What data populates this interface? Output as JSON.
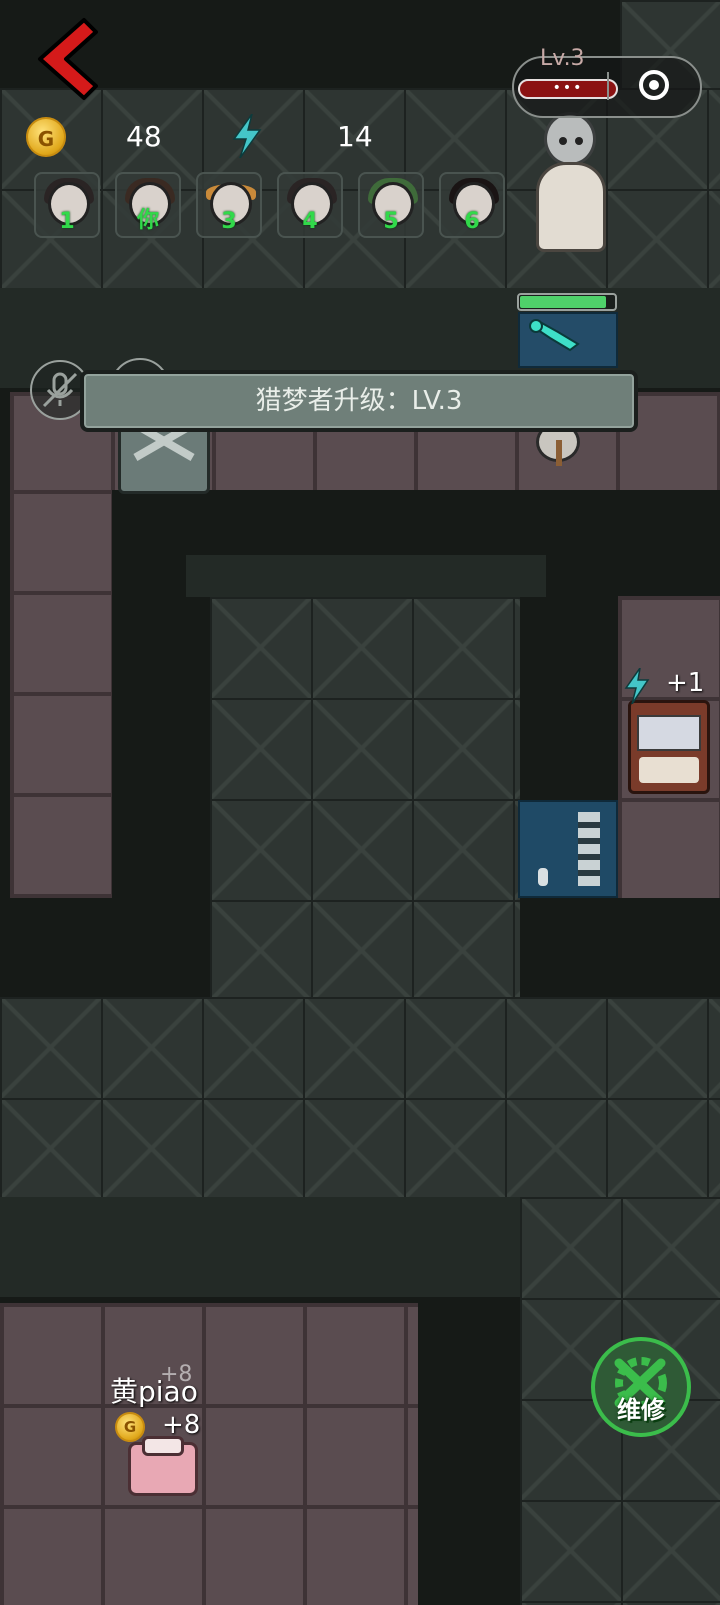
{
  "hud": {
    "gold": "48",
    "energy": "14",
    "coin_symbol": "G",
    "level_label": "Lv.3",
    "capsule_dots": "•••"
  },
  "slots": [
    {
      "num": "1",
      "hair": "#2a2424"
    },
    {
      "num": "你",
      "hair": "#3a2a22"
    },
    {
      "num": "3",
      "hair": "#c98a3a"
    },
    {
      "num": "4",
      "hair": "#2a2424"
    },
    {
      "num": "5",
      "hair": "#3f6b3a"
    },
    {
      "num": "6",
      "hair": "#1a1414"
    }
  ],
  "banner": {
    "text": "猎梦者升级：LV.3"
  },
  "machine": {
    "bonus": "+1"
  },
  "player": {
    "name": "黄piao",
    "gold_gain": "+8",
    "gold_gain_faded": "+8"
  },
  "repair_button": {
    "label": "维修"
  },
  "colors": {
    "back_arrow": "#d51a1a",
    "slot_number": "#31d94a",
    "repair_ring": "#3bbd4b",
    "energy_bolt": "#44c6c9",
    "hunter_hp": "#4fd16a"
  },
  "icons": [
    "back-arrow-icon",
    "coin-icon",
    "lightning-icon",
    "more-dots-icon",
    "target-icon",
    "mic-off-icon",
    "wrench-icon",
    "gear-wrench-icon"
  ]
}
